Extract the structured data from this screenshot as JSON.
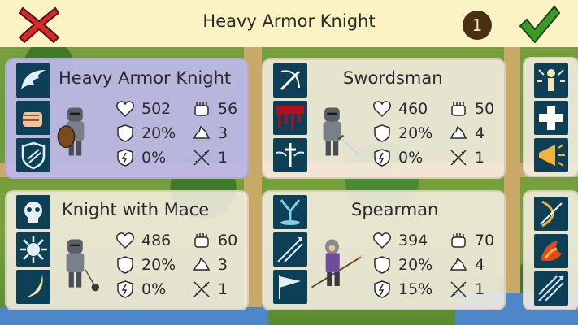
{
  "header": {
    "title": "Heavy Armor Knight",
    "badge_count": "1",
    "cancel_icon": "close-x-icon",
    "confirm_icon": "checkmark-icon"
  },
  "colors": {
    "bar": "#fbf3c3",
    "skill_bg": "#0d3f56",
    "cancel": "#d42a2a",
    "confirm": "#3c9a2a",
    "selected_card": "#bdb9ec"
  },
  "units": [
    {
      "name": "Heavy Armor Knight",
      "selected": true,
      "skills": [
        "wing-icon",
        "fist-icon",
        "shield-icon"
      ],
      "hp": "502",
      "attack": "56",
      "defense": "20%",
      "speed": "3",
      "evasion": "0%",
      "range": "1"
    },
    {
      "name": "Swordsman",
      "selected": false,
      "skills": [
        "slash-icon",
        "bleed-icon",
        "sword-wings-icon"
      ],
      "hp": "460",
      "attack": "50",
      "defense": "20%",
      "speed": "4",
      "evasion": "0%",
      "range": "1"
    },
    {
      "name": "Knight with Mace",
      "selected": false,
      "skills": [
        "skull-icon",
        "spike-ball-icon",
        "crescent-icon"
      ],
      "hp": "486",
      "attack": "60",
      "defense": "20%",
      "speed": "3",
      "evasion": "0%",
      "range": "1"
    },
    {
      "name": "Spearman",
      "selected": false,
      "skills": [
        "down-arrow-icon",
        "spear-tips-icon",
        "flag-icon"
      ],
      "hp": "394",
      "attack": "70",
      "defense": "20%",
      "speed": "4",
      "evasion": "15%",
      "range": "1"
    }
  ],
  "side_skills": [
    [
      "figure-glow-icon",
      "cross-icon",
      "horn-icon"
    ],
    [
      "bow-icon",
      "fire-icon",
      "arrows-icon"
    ]
  ]
}
